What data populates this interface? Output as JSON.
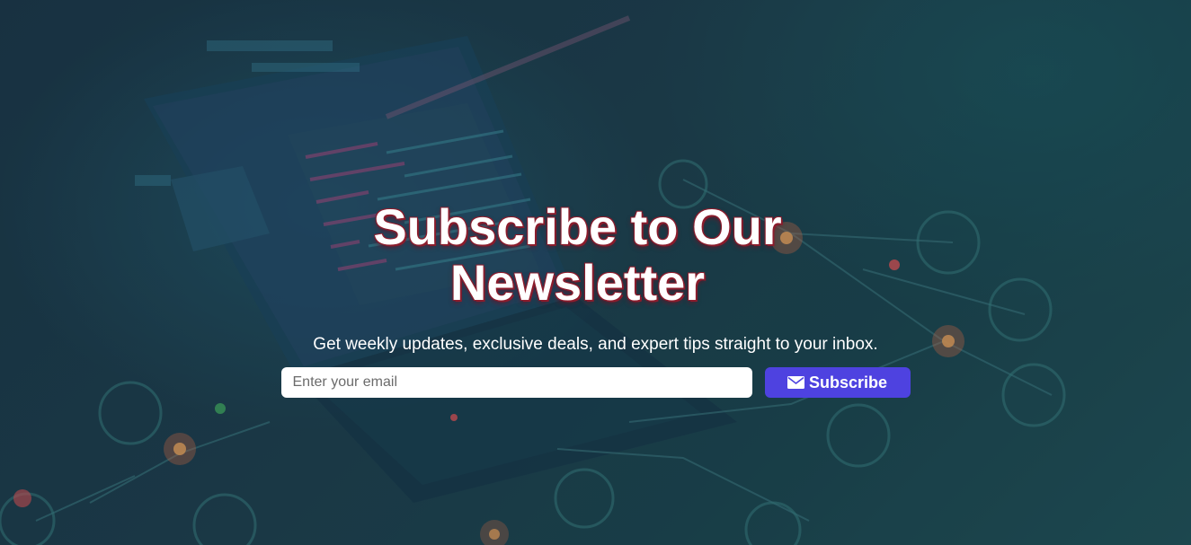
{
  "hero": {
    "title": "Subscribe to Our Newsletter",
    "subtitle": "Get weekly updates, exclusive deals, and expert tips straight to your inbox.",
    "email_placeholder": "Enter your email",
    "email_value": "",
    "subscribe_label": "Subscribe",
    "button_icon": "envelope-icon"
  },
  "colors": {
    "button_bg": "#4e42e0",
    "title_shadow": "#8b1c2c",
    "backdrop": "#1f4350"
  }
}
